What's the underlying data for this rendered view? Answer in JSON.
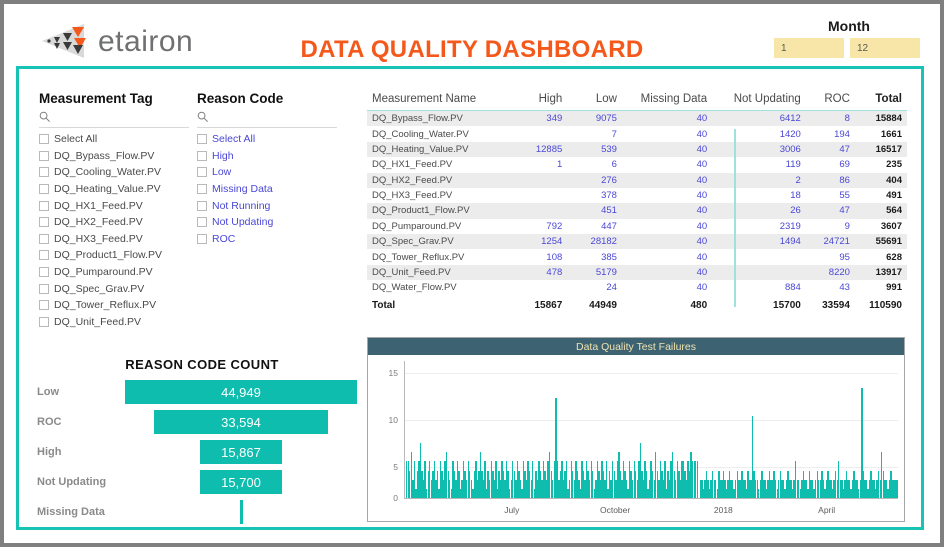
{
  "header": {
    "logo_text": "etairon",
    "logo_icon": "etairon-triangle-logo",
    "title": "DATA QUALITY DASHBOARD",
    "month_label": "Month",
    "month_from": "1",
    "month_to": "12"
  },
  "slicers": {
    "measurement_tag": {
      "title": "Measurement Tag",
      "search_icon": "search-icon",
      "search_placeholder": "",
      "options": [
        "Select All",
        "DQ_Bypass_Flow.PV",
        "DQ_Cooling_Water.PV",
        "DQ_Heating_Value.PV",
        "DQ_HX1_Feed.PV",
        "DQ_HX2_Feed.PV",
        "DQ_HX3_Feed.PV",
        "DQ_Product1_Flow.PV",
        "DQ_Pumparound.PV",
        "DQ_Spec_Grav.PV",
        "DQ_Tower_Reflux.PV",
        "DQ_Unit_Feed.PV"
      ]
    },
    "reason_code": {
      "title": "Reason Code",
      "search_icon": "search-icon",
      "search_placeholder": "",
      "options": [
        "Select All",
        "High",
        "Low",
        "Missing Data",
        "Not Running",
        "Not Updating",
        "ROC"
      ]
    }
  },
  "table": {
    "columns": [
      "Measurement Name",
      "High",
      "Low",
      "Missing Data",
      "Not Updating",
      "ROC",
      "Total"
    ],
    "rows": [
      {
        "name": "DQ_Bypass_Flow.PV",
        "high": "349",
        "low": "9075",
        "missing": "40",
        "not_updating": "6412",
        "roc": "8",
        "total": "15884"
      },
      {
        "name": "DQ_Cooling_Water.PV",
        "high": "",
        "low": "7",
        "missing": "40",
        "not_updating": "1420",
        "roc": "194",
        "total": "1661"
      },
      {
        "name": "DQ_Heating_Value.PV",
        "high": "12885",
        "low": "539",
        "missing": "40",
        "not_updating": "3006",
        "roc": "47",
        "total": "16517"
      },
      {
        "name": "DQ_HX1_Feed.PV",
        "high": "1",
        "low": "6",
        "missing": "40",
        "not_updating": "119",
        "roc": "69",
        "total": "235"
      },
      {
        "name": "DQ_HX2_Feed.PV",
        "high": "",
        "low": "276",
        "missing": "40",
        "not_updating": "2",
        "roc": "86",
        "total": "404"
      },
      {
        "name": "DQ_HX3_Feed.PV",
        "high": "",
        "low": "378",
        "missing": "40",
        "not_updating": "18",
        "roc": "55",
        "total": "491"
      },
      {
        "name": "DQ_Product1_Flow.PV",
        "high": "",
        "low": "451",
        "missing": "40",
        "not_updating": "26",
        "roc": "47",
        "total": "564"
      },
      {
        "name": "DQ_Pumparound.PV",
        "high": "792",
        "low": "447",
        "missing": "40",
        "not_updating": "2319",
        "roc": "9",
        "total": "3607"
      },
      {
        "name": "DQ_Spec_Grav.PV",
        "high": "1254",
        "low": "28182",
        "missing": "40",
        "not_updating": "1494",
        "roc": "24721",
        "total": "55691"
      },
      {
        "name": "DQ_Tower_Reflux.PV",
        "high": "108",
        "low": "385",
        "missing": "40",
        "not_updating": "",
        "roc": "95",
        "total": "628"
      },
      {
        "name": "DQ_Unit_Feed.PV",
        "high": "478",
        "low": "5179",
        "missing": "40",
        "not_updating": "",
        "roc": "8220",
        "total": "13917"
      },
      {
        "name": "DQ_Water_Flow.PV",
        "high": "",
        "low": "24",
        "missing": "40",
        "not_updating": "884",
        "roc": "43",
        "total": "991"
      }
    ],
    "total_row": {
      "name": "Total",
      "high": "15867",
      "low": "44949",
      "missing": "480",
      "not_updating": "15700",
      "roc": "33594",
      "total": "110590"
    }
  },
  "chart_data": [
    {
      "type": "bar",
      "title": "REASON CODE COUNT",
      "orientation": "horizontal-funnel",
      "categories": [
        "Low",
        "ROC",
        "High",
        "Not Updating",
        "Missing Data"
      ],
      "values": [
        44949,
        33594,
        15867,
        15700,
        480
      ],
      "labels": [
        "44,949",
        "33,594",
        "15,867",
        "15,700",
        ""
      ],
      "xlabel": "",
      "ylabel": "",
      "grid": false,
      "legend": "none",
      "bar_color": "#0fbdae"
    },
    {
      "type": "bar",
      "title": "Data Quality Test Failures",
      "xlabel": "",
      "ylabel": "",
      "ylim": [
        0,
        15
      ],
      "yticks": [
        0,
        5,
        10,
        15
      ],
      "ytick_labels": [
        "0",
        "5",
        "10",
        "15"
      ],
      "xtick_labels": [
        "July",
        "October",
        "2018",
        "April"
      ],
      "xtick_positions_pct": [
        21.5,
        42.5,
        64.5,
        85.5
      ],
      "grid": true,
      "legend": "none",
      "bar_color": "#0fbdae",
      "series_note": "daily failure counts, gap in series near November",
      "values": [
        4,
        4,
        3,
        5,
        2,
        4,
        1,
        3,
        4,
        6,
        3,
        2,
        4,
        1,
        3,
        4,
        2,
        3,
        4,
        2,
        3,
        1,
        4,
        3,
        2,
        4,
        5,
        3,
        2,
        1,
        4,
        3,
        2,
        4,
        3,
        1,
        2,
        4,
        3,
        2,
        4,
        3,
        2,
        1,
        3,
        4,
        2,
        3,
        5,
        3,
        2,
        4,
        1,
        3,
        2,
        4,
        3,
        2,
        4,
        1,
        3,
        2,
        4,
        3,
        2,
        4,
        3,
        1,
        2,
        4,
        3,
        2,
        4,
        3,
        2,
        1,
        4,
        3,
        2,
        4,
        3,
        2,
        4,
        1,
        3,
        2,
        4,
        3,
        2,
        4,
        3,
        2,
        4,
        5,
        3,
        2,
        4,
        11,
        4,
        2,
        3,
        4,
        2,
        3,
        4,
        1,
        2,
        4,
        3,
        2,
        4,
        3,
        2,
        1,
        4,
        3,
        2,
        4,
        3,
        2,
        4,
        3,
        1,
        2,
        4,
        3,
        2,
        4,
        3,
        2,
        4,
        1,
        3,
        2,
        4,
        3,
        2,
        4,
        5,
        3,
        2,
        4,
        3,
        2,
        1,
        4,
        3,
        2,
        4,
        3,
        2,
        4,
        6,
        3,
        2,
        4,
        3,
        1,
        2,
        4,
        3,
        2,
        5,
        3,
        2,
        4,
        3,
        2,
        4,
        1,
        3,
        2,
        4,
        5,
        3,
        2,
        4,
        3,
        2,
        4,
        4,
        3,
        2,
        4,
        3,
        5,
        4,
        4,
        4,
        4,
        0,
        2,
        2,
        1,
        2,
        3,
        2,
        1,
        2,
        3,
        2,
        2,
        1,
        3,
        2,
        2,
        3,
        2,
        1,
        2,
        3,
        2,
        2,
        1,
        2,
        3,
        2,
        2,
        3,
        2,
        2,
        1,
        3,
        2,
        2,
        9,
        3,
        2,
        2,
        1,
        2,
        3,
        2,
        2,
        1,
        2,
        3,
        2,
        2,
        3,
        2,
        1,
        2,
        3,
        2,
        2,
        1,
        2,
        3,
        2,
        2,
        1,
        2,
        4,
        2,
        2,
        1,
        2,
        3,
        2,
        2,
        1,
        3,
        2,
        2,
        1,
        2,
        3,
        2,
        2,
        3,
        2,
        1,
        2,
        3,
        2,
        2,
        1,
        2,
        3,
        2,
        4,
        2,
        2,
        1,
        2,
        3,
        2,
        2,
        1,
        2,
        3,
        2,
        2,
        1,
        2,
        12,
        3,
        2,
        2,
        1,
        2,
        3,
        2,
        2,
        1,
        2,
        3,
        2,
        5,
        3,
        2,
        2,
        1,
        2,
        3,
        2,
        2,
        2,
        2
      ]
    }
  ]
}
